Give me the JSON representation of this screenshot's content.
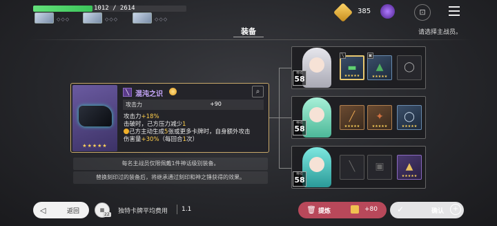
{
  "top": {
    "hp_text": "1012 / 2614",
    "hp_fraction": 0.387,
    "team_pips": [
      "◇◇◇",
      "◇◇◇",
      "◇◇◇"
    ],
    "currency_value": "385",
    "icons": [
      "gem-icon",
      "orb-icon",
      "lock-icon",
      "menu-icon"
    ]
  },
  "title": "装备",
  "hint": "请选择主战员。",
  "item": {
    "name": "混沌之识",
    "type_glyph": "╲",
    "stars": "★★★★★",
    "stat_label": "攻击力",
    "stat_value": "+90",
    "line1_a": "攻击力",
    "line1_b": "+18%",
    "line2_a": "击破时，己方压力减少",
    "line2_b": "1",
    "line3_a": "己方主动生成",
    "line3_b": "5",
    "line3_c": "张或更多卡牌时，自身额外攻击",
    "line4_a": "伤害量",
    "line4_b": "+30%",
    "line4_c": "（每回合",
    "line4_d": "1",
    "line4_e": "次）"
  },
  "notes": {
    "note1": "每名主战员仅限佩戴1件神话级别装备。",
    "note2": "替换刻印过的装备后，将继承通过刻印和神之锤获得的效果。"
  },
  "characters": [
    {
      "level_label": "等级",
      "level": "58",
      "hair": "#c9c9d2",
      "slots": [
        {
          "type": "weapon",
          "stars": "★★★★★"
        },
        {
          "type": "armor",
          "stars": "★★★★★"
        },
        {
          "type": "ring-empty",
          "stars": ""
        }
      ]
    },
    {
      "level_label": "等级",
      "level": "58",
      "hair": "#7fd8b8",
      "slots": [
        {
          "type": "weapon",
          "stars": "★★★★★"
        },
        {
          "type": "armor",
          "stars": "★★★★★"
        },
        {
          "type": "ring",
          "stars": "★★★★★"
        }
      ]
    },
    {
      "level_label": "等级",
      "level": "58",
      "hair": "#4ec9c4",
      "slots": [
        {
          "type": "weapon-empty",
          "stars": ""
        },
        {
          "type": "armor-empty",
          "stars": ""
        },
        {
          "type": "relic",
          "stars": "★★★★★"
        }
      ]
    }
  ],
  "bottom": {
    "back_label": "返回",
    "deck_badge": "22",
    "deck_label": "独特卡牌平均费用",
    "deck_value": "1.1",
    "refine_label": "提炼",
    "refine_value": "+80",
    "confirm_label": "确认"
  },
  "colors": {
    "hp": "#4fd06a",
    "refine": "#b8485a",
    "gold_border": "#c9a96a",
    "item_name": "#c9a9ff",
    "highlight": "#ffcf4a"
  }
}
